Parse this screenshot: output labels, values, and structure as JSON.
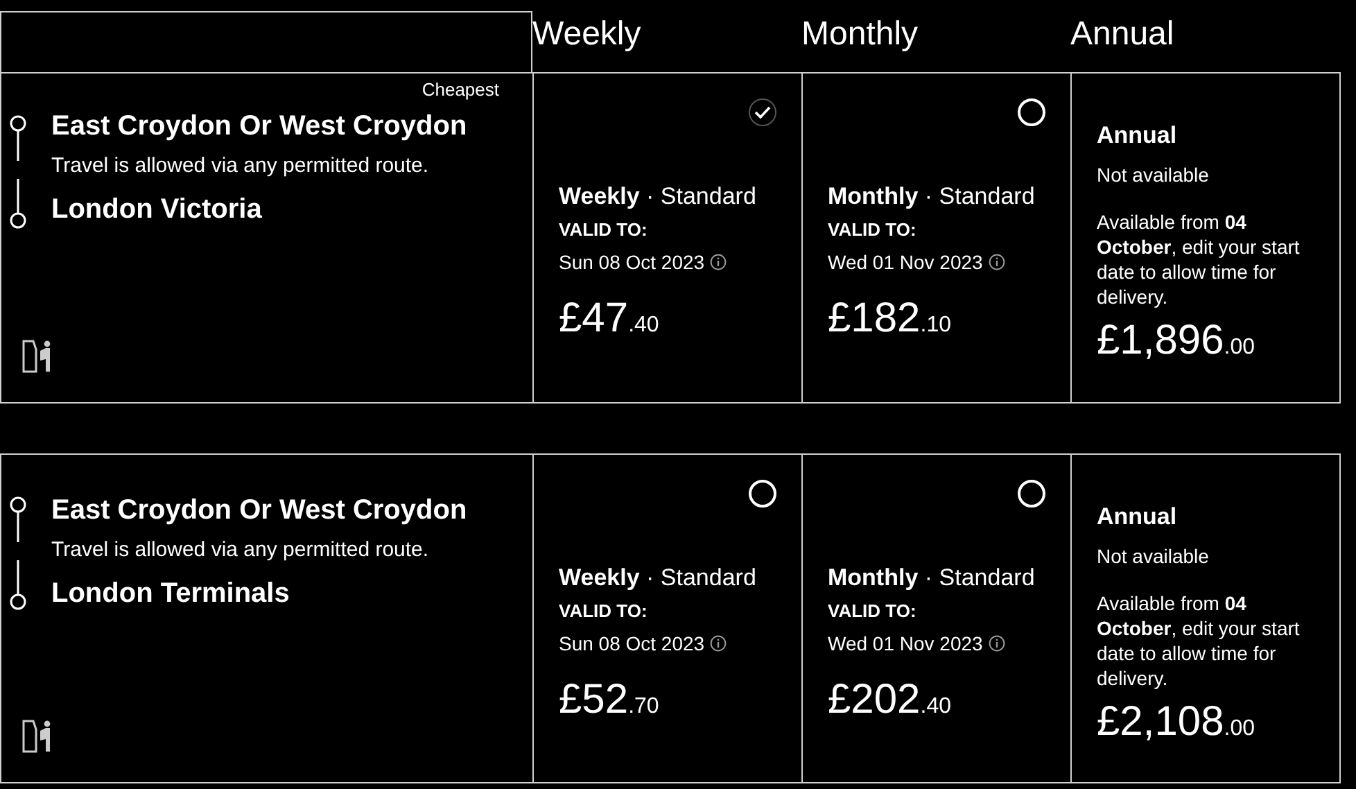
{
  "header": {
    "columns": [
      "Weekly",
      "Monthly",
      "Annual"
    ]
  },
  "rows": [
    {
      "badge": "Cheapest",
      "origin": "East Croydon Or West Croydon",
      "route_note": "Travel is allowed via any permitted route.",
      "destination": "London Victoria",
      "options": [
        {
          "kind": "fare",
          "selected": true,
          "name": "Weekly",
          "ticket_class": "· Standard",
          "valid_label": "VALID TO:",
          "valid_date": "Sun 08 Oct 2023",
          "price": "£47",
          "pence": ".40"
        },
        {
          "kind": "fare",
          "selected": false,
          "name": "Monthly",
          "ticket_class": "· Standard",
          "valid_label": "VALID TO:",
          "valid_date": "Wed 01 Nov 2023",
          "price": "£182",
          "pence": ".10"
        },
        {
          "kind": "unavailable",
          "name": "Annual",
          "status": "Not available",
          "message": "Available from **04 October**, edit your start date to allow time for delivery.",
          "price": "£1,896",
          "pence": ".00"
        }
      ]
    },
    {
      "origin": "East Croydon Or West Croydon",
      "route_note": "Travel is allowed via any permitted route.",
      "destination": "London Terminals",
      "options": [
        {
          "kind": "fare",
          "selected": false,
          "name": "Weekly",
          "ticket_class": "· Standard",
          "valid_label": "VALID TO:",
          "valid_date": "Sun 08 Oct 2023",
          "price": "£52",
          "pence": ".70"
        },
        {
          "kind": "fare",
          "selected": false,
          "name": "Monthly",
          "ticket_class": "· Standard",
          "valid_label": "VALID TO:",
          "valid_date": "Wed 01 Nov 2023",
          "price": "£202",
          "pence": ".40"
        },
        {
          "kind": "unavailable",
          "name": "Annual",
          "status": "Not available",
          "message": "Available from **04 October**, edit your start date to allow time for delivery.",
          "price": "£2,108",
          "pence": ".00"
        }
      ]
    }
  ]
}
